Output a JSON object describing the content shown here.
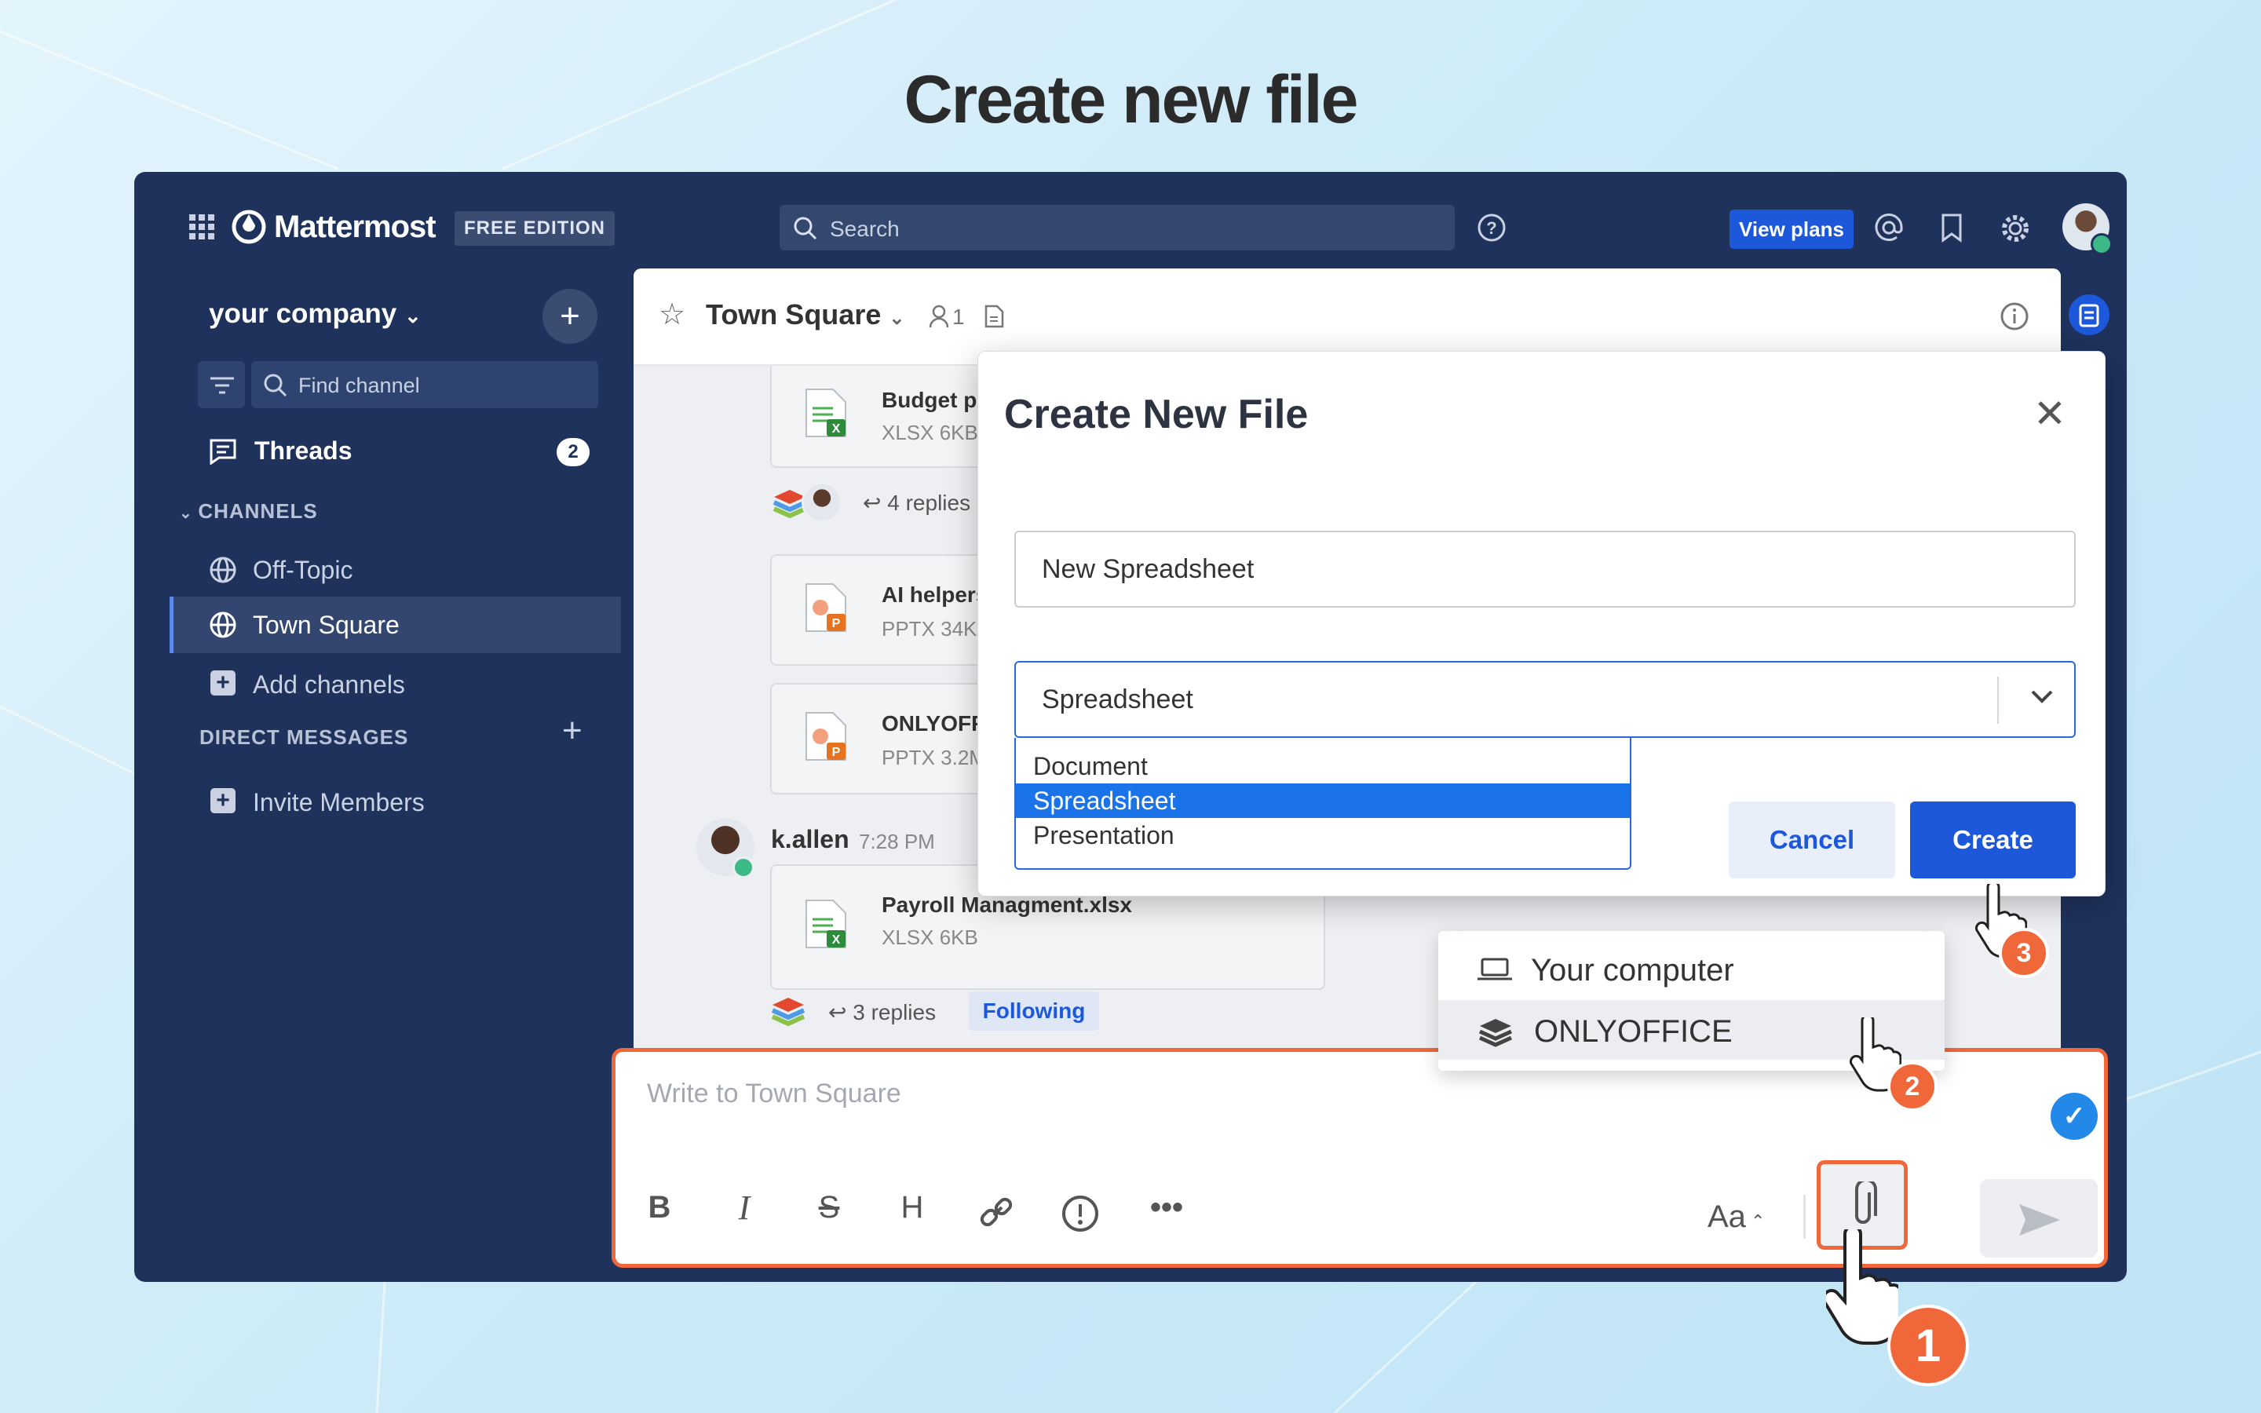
{
  "page_title": "Create new file",
  "app": {
    "brand": "Mattermost",
    "edition": "FREE EDITION",
    "search_placeholder": "Search",
    "view_plans": "View plans"
  },
  "sidebar": {
    "team": "your company",
    "find_channel": "Find channel",
    "threads": "Threads",
    "threads_count": "2",
    "channels_header": "CHANNELS",
    "channels": [
      "Off-Topic",
      "Town Square"
    ],
    "add_channels": "Add channels",
    "dm_header": "DIRECT MESSAGES",
    "invite": "Invite Members"
  },
  "channel": {
    "name": "Town Square",
    "member_count": "1"
  },
  "posts": {
    "file1_name": "Budget pl",
    "file1_meta": "XLSX 6KB",
    "replies1": "4 replies",
    "file2_name": "AI helpers",
    "file2_meta": "PPTX 34K",
    "file3_name": "ONLYOFF",
    "file3_meta": "PPTX 3.2M",
    "author": "k.allen",
    "time": "7:28 PM",
    "file4_name": "Payroll Managment.xlsx",
    "file4_meta": "XLSX 6KB",
    "replies2": "3 replies",
    "following": "Following"
  },
  "composer": {
    "placeholder": "Write to Town Square",
    "aa": "Aa"
  },
  "attach_menu": {
    "items": [
      "Your computer",
      "ONLYOFFICE"
    ]
  },
  "modal": {
    "title": "Create New File",
    "name_value": "New Spreadsheet",
    "type_value": "Spreadsheet",
    "options": [
      "Document",
      "Spreadsheet",
      "Presentation"
    ],
    "cancel": "Cancel",
    "create": "Create"
  },
  "steps": [
    "1",
    "2",
    "3"
  ],
  "colors": {
    "sidebar": "#1e325c",
    "accent": "#1c58d9",
    "step": "#f0673a",
    "selected_option": "#1a73e8"
  }
}
